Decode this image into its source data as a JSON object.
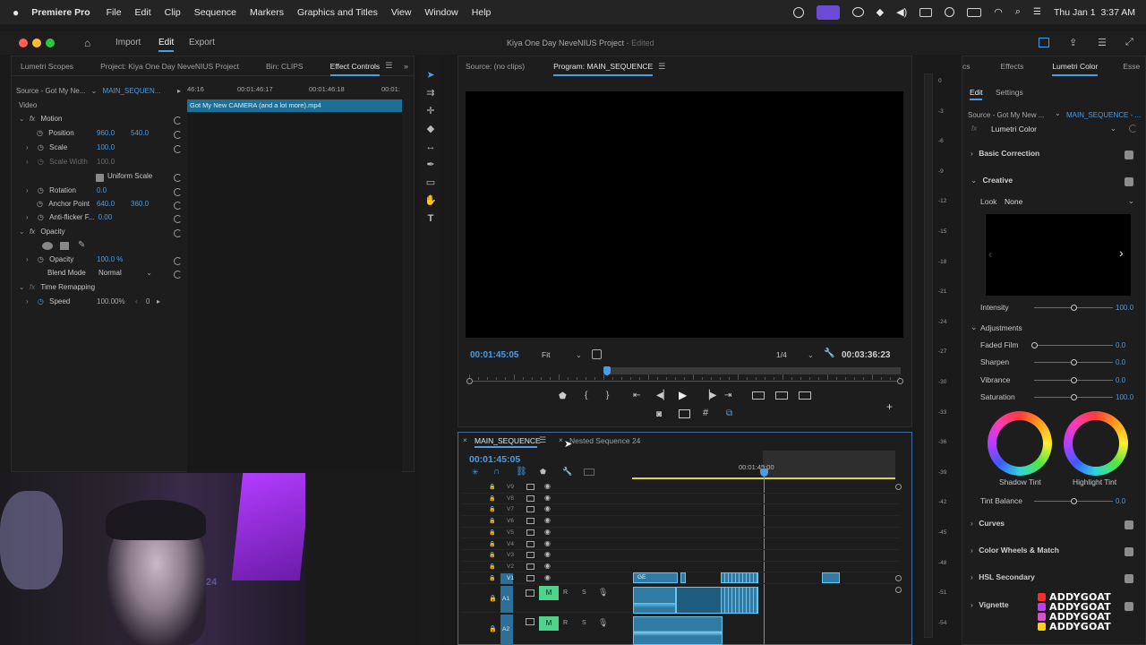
{
  "menubar": {
    "app": "Premiere Pro",
    "items": [
      "File",
      "Edit",
      "Clip",
      "Sequence",
      "Markers",
      "Graphics and Titles",
      "View",
      "Window",
      "Help"
    ],
    "clock": "Thu Jan 1  3:37 AM"
  },
  "window": {
    "title": "Kiya One Day NeveNIUS Project",
    "status": "- Edited",
    "tabs": {
      "import": "Import",
      "edit": "Edit",
      "export": "Export"
    }
  },
  "left_panel": {
    "tabs": {
      "scopes": "Lumetri Scopes",
      "project": "Project: Kiya One Day NeveNIUS Project",
      "bin": "Bin: CLIPS",
      "effects": "Effect Controls"
    },
    "source": "Source - Got My Ne...",
    "sequence": "MAIN_SEQUEN...",
    "ruler": [
      "46:16",
      "00:01:46:17",
      "00:01:46:18",
      "00:01:"
    ],
    "clip_name": "Got My New CAMERA (and a lot more).mp4",
    "video_label": "Video",
    "motion": "Motion",
    "position_label": "Position",
    "position_x": "960.0",
    "position_y": "540.0",
    "scale_label": "Scale",
    "scale": "100.0",
    "scale_width_label": "Scale Width",
    "scale_width": "100.0",
    "uniform_scale": "Uniform Scale",
    "rotation_label": "Rotation",
    "rotation": "0.0",
    "anchor_label": "Anchor Point",
    "anchor_x": "640.0",
    "anchor_y": "360.0",
    "antiflicker_label": "Anti-flicker F...",
    "antiflicker": "0.00",
    "opacity_group": "Opacity",
    "opacity_label": "Opacity",
    "opacity": "100.0 %",
    "blend_label": "Blend Mode",
    "blend": "Normal",
    "time_remap": "Time Remapping",
    "speed_label": "Speed",
    "speed": "100.00%",
    "speed_extra": "0"
  },
  "program": {
    "source_tab": "Source: (no clips)",
    "program_tab": "Program: MAIN_SEQUENCE",
    "timecode": "00:01:45:05",
    "fit": "Fit",
    "quality": "1/4",
    "duration": "00:03:36:23",
    "playhead_fraction": 0.32
  },
  "timeline": {
    "tab1": "MAIN_SEQUENCE",
    "tab2": "Nested Sequence 24",
    "timecode": "00:01:45:05",
    "ruler_label": "00:01:45:00",
    "video_tracks": [
      "V9",
      "V8",
      "V7",
      "V6",
      "V5",
      "V4",
      "V3",
      "V2",
      "V1"
    ],
    "audio_tracks": [
      "A1",
      "A2"
    ],
    "clip_label": "GE",
    "m_label": "M",
    "r_label": "R",
    "s_label": "S"
  },
  "meter": {
    "ticks": [
      "0",
      "-3",
      "-6",
      "-9",
      "-12",
      "-15",
      "-18",
      "-21",
      "-24",
      "-27",
      "-30",
      "-33",
      "-36",
      "-39",
      "-42",
      "-45",
      "-48",
      "-51",
      "-54"
    ]
  },
  "lumetri": {
    "tabs": {
      "partial": "cs",
      "effects": "Effects",
      "color": "Lumetri Color",
      "essential": "Esse"
    },
    "subtabs": {
      "edit": "Edit",
      "settings": "Settings"
    },
    "source": "Source - Got My New ...",
    "sequence": "MAIN_SEQUENCE - ...",
    "effect": "Lumetri Color",
    "basic": "Basic Correction",
    "creative": "Creative",
    "look_label": "Look",
    "look": "None",
    "intensity_label": "Intensity",
    "intensity": "100.0",
    "adjustments": "Adjustments",
    "faded_label": "Faded Film",
    "faded": "0.0",
    "sharpen_label": "Sharpen",
    "sharpen": "0.0",
    "vibrance_label": "Vibrance",
    "vibrance": "0.0",
    "saturation_label": "Saturation",
    "saturation": "100.0",
    "shadow_tint": "Shadow Tint",
    "highlight_tint": "Highlight Tint",
    "tint_balance_label": "Tint Balance",
    "tint_balance": "0.0",
    "curves": "Curves",
    "wheels": "Color Wheels & Match",
    "hsl": "HSL Secondary",
    "vignette": "Vignette"
  },
  "watermark": [
    "ADDYGOAT",
    "ADDYGOAT",
    "ADDYGOAT",
    "ADDYGOAT"
  ],
  "webcam_jersey": "24",
  "colors": {
    "accent": "#4a9de6",
    "clip": "#2f7ba4",
    "audio_mute": "#4fd38a",
    "playhead": "#4a9de6"
  }
}
